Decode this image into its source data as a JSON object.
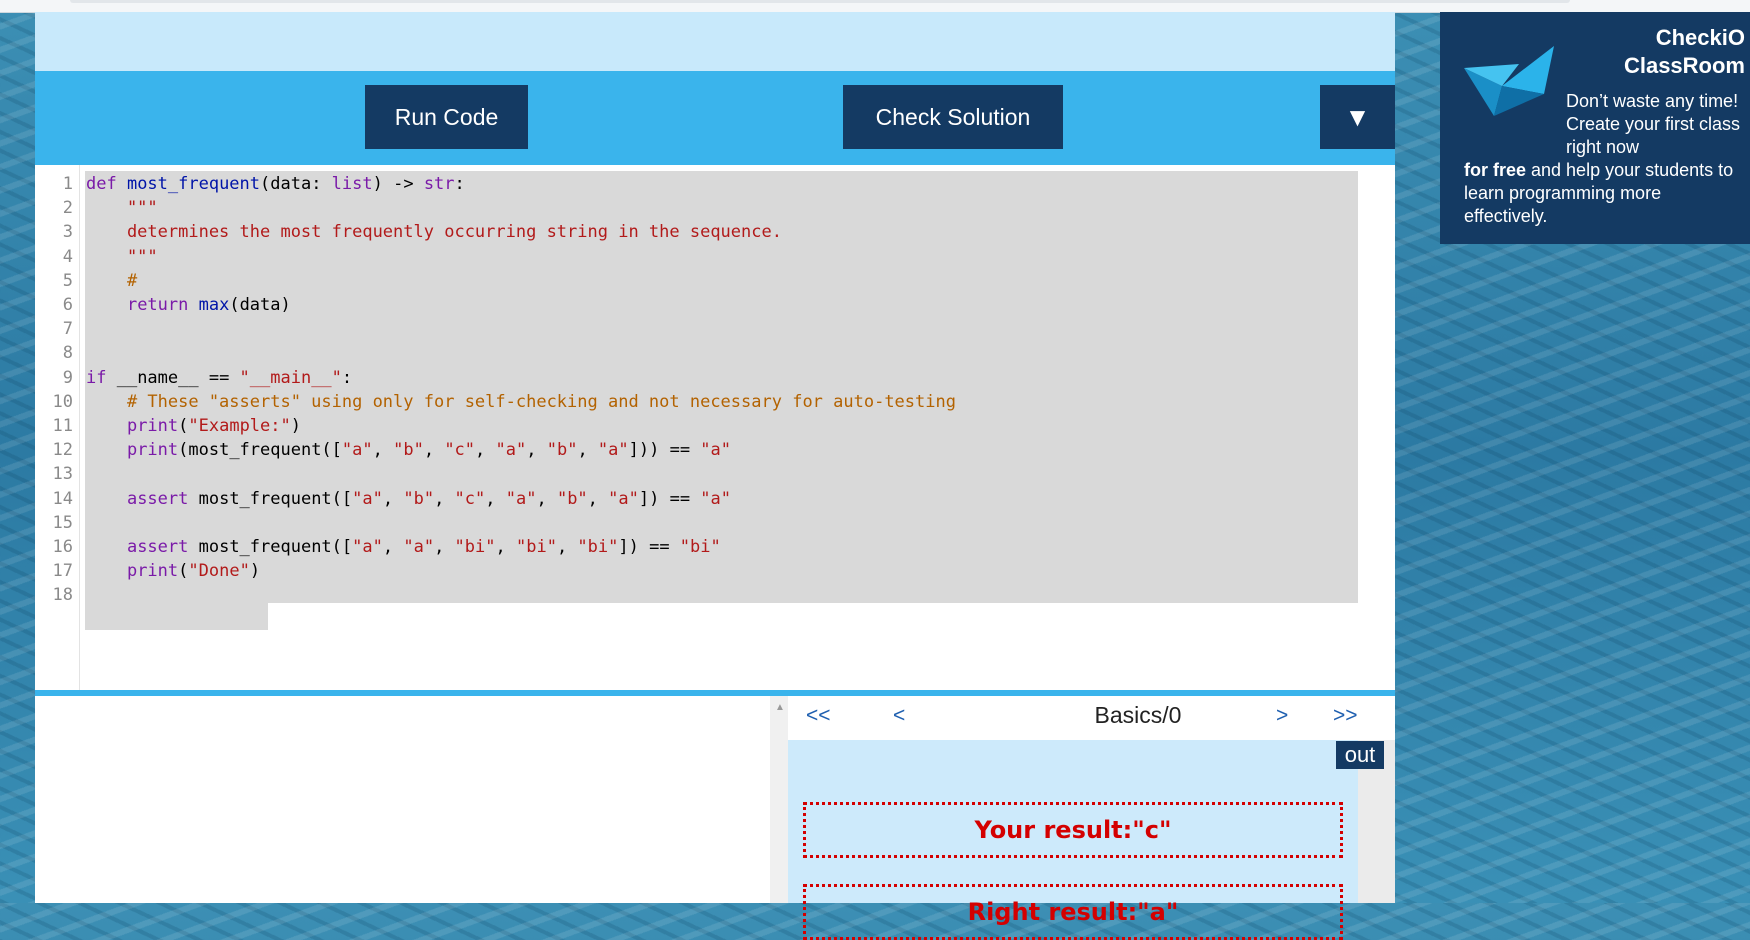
{
  "toolbar": {
    "run_label": "Run Code",
    "check_label": "Check Solution",
    "dropdown_label": "▼"
  },
  "editor": {
    "line_numbers": [
      "1",
      "2",
      "3",
      "4",
      "5",
      "6",
      "7",
      "8",
      "9",
      "10",
      "11",
      "12",
      "13",
      "14",
      "15",
      "16",
      "17",
      "18"
    ],
    "lines": [
      [
        {
          "t": "def ",
          "c": "kw"
        },
        {
          "t": "most_frequent",
          "c": "fn"
        },
        {
          "t": "(data: "
        },
        {
          "t": "list",
          "c": "kw"
        },
        {
          "t": ") -> "
        },
        {
          "t": "str",
          "c": "kw"
        },
        {
          "t": ":"
        }
      ],
      [
        {
          "t": "    \"\"\"",
          "c": "st"
        }
      ],
      [
        {
          "t": "    determines the most frequently occurring string in the sequence.",
          "c": "st"
        }
      ],
      [
        {
          "t": "    \"\"\"",
          "c": "st"
        }
      ],
      [
        {
          "t": "    #",
          "c": "cm"
        }
      ],
      [
        {
          "t": "    "
        },
        {
          "t": "return ",
          "c": "kw"
        },
        {
          "t": "max",
          "c": "fn"
        },
        {
          "t": "(data)"
        }
      ],
      [],
      [],
      [
        {
          "t": "if ",
          "c": "kw"
        },
        {
          "t": "__name__ == "
        },
        {
          "t": "\"__main__\"",
          "c": "st"
        },
        {
          "t": ":"
        }
      ],
      [
        {
          "t": "    # These \"asserts\" using only for self-checking and not necessary for auto-testing",
          "c": "cm"
        }
      ],
      [
        {
          "t": "    "
        },
        {
          "t": "print",
          "c": "kw"
        },
        {
          "t": "("
        },
        {
          "t": "\"Example:\"",
          "c": "st"
        },
        {
          "t": ")"
        }
      ],
      [
        {
          "t": "    "
        },
        {
          "t": "print",
          "c": "kw"
        },
        {
          "t": "(most_frequent(["
        },
        {
          "t": "\"a\"",
          "c": "st"
        },
        {
          "t": ", "
        },
        {
          "t": "\"b\"",
          "c": "st"
        },
        {
          "t": ", "
        },
        {
          "t": "\"c\"",
          "c": "st"
        },
        {
          "t": ", "
        },
        {
          "t": "\"a\"",
          "c": "st"
        },
        {
          "t": ", "
        },
        {
          "t": "\"b\"",
          "c": "st"
        },
        {
          "t": ", "
        },
        {
          "t": "\"a\"",
          "c": "st"
        },
        {
          "t": "])) == "
        },
        {
          "t": "\"a\"",
          "c": "st"
        }
      ],
      [],
      [
        {
          "t": "    "
        },
        {
          "t": "assert ",
          "c": "kw"
        },
        {
          "t": "most_frequent(["
        },
        {
          "t": "\"a\"",
          "c": "st"
        },
        {
          "t": ", "
        },
        {
          "t": "\"b\"",
          "c": "st"
        },
        {
          "t": ", "
        },
        {
          "t": "\"c\"",
          "c": "st"
        },
        {
          "t": ", "
        },
        {
          "t": "\"a\"",
          "c": "st"
        },
        {
          "t": ", "
        },
        {
          "t": "\"b\"",
          "c": "st"
        },
        {
          "t": ", "
        },
        {
          "t": "\"a\"",
          "c": "st"
        },
        {
          "t": "]) == "
        },
        {
          "t": "\"a\"",
          "c": "st"
        }
      ],
      [],
      [
        {
          "t": "    "
        },
        {
          "t": "assert ",
          "c": "kw"
        },
        {
          "t": "most_frequent(["
        },
        {
          "t": "\"a\"",
          "c": "st"
        },
        {
          "t": ", "
        },
        {
          "t": "\"a\"",
          "c": "st"
        },
        {
          "t": ", "
        },
        {
          "t": "\"bi\"",
          "c": "st"
        },
        {
          "t": ", "
        },
        {
          "t": "\"bi\"",
          "c": "st"
        },
        {
          "t": ", "
        },
        {
          "t": "\"bi\"",
          "c": "st"
        },
        {
          "t": "]) == "
        },
        {
          "t": "\"bi\"",
          "c": "st"
        }
      ],
      [
        {
          "t": "    "
        },
        {
          "t": "print",
          "c": "kw"
        },
        {
          "t": "("
        },
        {
          "t": "\"Done\"",
          "c": "st"
        },
        {
          "t": ")"
        }
      ],
      []
    ]
  },
  "results": {
    "nav_first": "<<",
    "nav_prev": "<",
    "title": "Basics/0",
    "nav_next": ">",
    "nav_last": ">>",
    "out_tab": "out",
    "your_result": "Your result:\"c\"",
    "right_result": "Right result:\"a\""
  },
  "promo": {
    "title_line1": "CheckiO",
    "title_line2": "ClassRoom",
    "text_indented": "Don’t waste any time! Create your first class right now",
    "text_bold": "for free",
    "text_rest": " and help your students to learn programming more effectively."
  },
  "colors": {
    "toolbar_blue": "#3ab4ec",
    "button_navy": "#143a63",
    "result_red": "#d40000"
  }
}
